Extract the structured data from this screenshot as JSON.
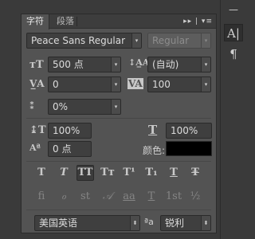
{
  "tabs": [
    {
      "label": "字符"
    },
    {
      "label": "段落"
    }
  ],
  "tab_tools": "▸▸ | ▾≡",
  "font": {
    "family": "Peace Sans Regular",
    "style": "Regular"
  },
  "size": {
    "value": "500 点",
    "leading": "(自动)"
  },
  "kerning": {
    "value": "0",
    "tracking": "100"
  },
  "tsume": {
    "value": "0%"
  },
  "scale": {
    "vertical": "100%",
    "horizontal": "100%"
  },
  "baseline": {
    "value": "0 点"
  },
  "color": {
    "label": "颜色:",
    "swatch": "#000000"
  },
  "style_buttons": [
    "T",
    "T",
    "TT",
    "Tт",
    "T¹",
    "T₁",
    "T",
    "Ŧ"
  ],
  "opentype_buttons": [
    "fi",
    "ℴ",
    "st",
    "𝒜",
    "aa",
    "T",
    "1st",
    "½"
  ],
  "language": {
    "value": "美国英语",
    "aa_label": "ªa",
    "antialias": "锐利"
  },
  "strip": {
    "top_glyph": "—⟶",
    "char_icon": "A|",
    "para_icon": "¶"
  }
}
